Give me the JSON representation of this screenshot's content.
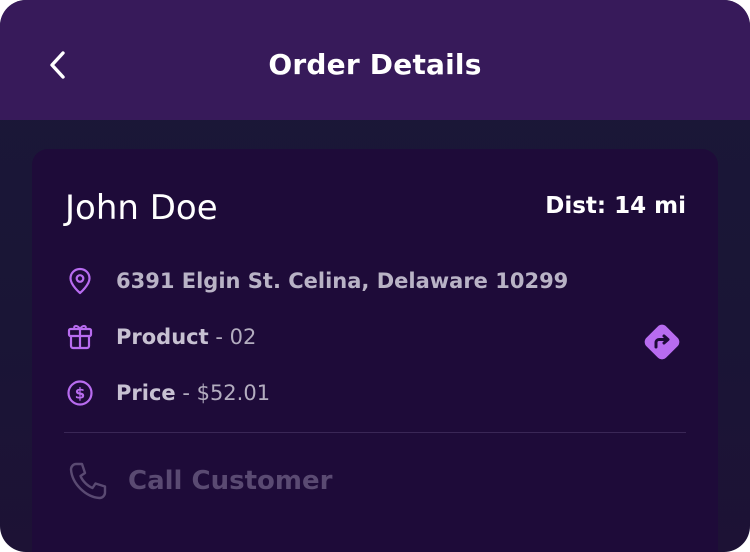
{
  "header": {
    "title": "Order Details",
    "back_icon": "chevron-left-icon"
  },
  "order": {
    "customer_name": "John Doe",
    "distance_label": "Dist: 14 mi",
    "address": "6391 Elgin St. Celina, Delaware 10299",
    "product": {
      "label": "Product",
      "separator": " - ",
      "value": "02"
    },
    "price": {
      "label": "Price",
      "separator": " - ",
      "value": "$52.01"
    }
  },
  "actions": {
    "call_label": "Call Customer",
    "directions_icon": "directions-icon"
  },
  "colors": {
    "header_bg": "#371a5a",
    "card_bg": "#1e0b39",
    "accent": "#b86cf0",
    "text_primary": "#ffffff",
    "text_muted": "#b9b3c6",
    "call_disabled": "#5a4a72"
  }
}
